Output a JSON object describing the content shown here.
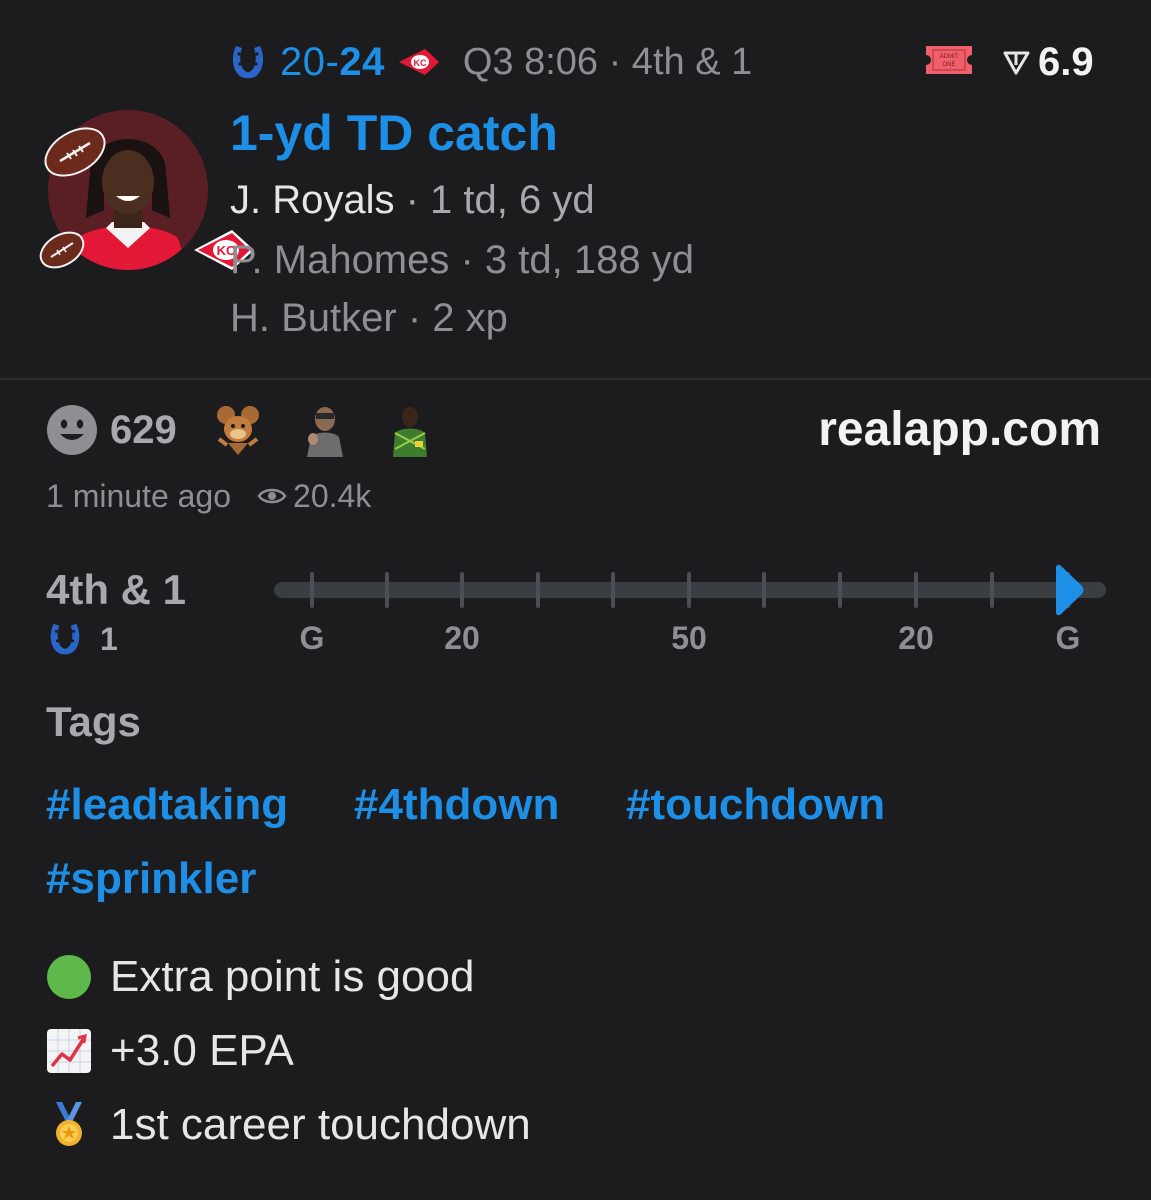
{
  "header": {
    "score_away": "20",
    "score_sep": "-",
    "score_home": "24",
    "game_status": "Q3 8:06 · 4th & 1",
    "ticket_text": "ADMIT ONE",
    "rating": "6.9"
  },
  "play": {
    "title": "1-yd TD catch",
    "stats": [
      {
        "name": "J. Royals",
        "line": " · 1 td, 6 yd"
      },
      {
        "name": "P. Mahomes",
        "line": " · 3 td, 188 yd"
      },
      {
        "name": "H. Butker",
        "line": " · 2 xp"
      }
    ]
  },
  "reactions": {
    "count": "629",
    "stickers": [
      "cartoon-mouse-sticker",
      "person-sticker",
      "goalkeeper-sticker"
    ],
    "site": "realapp.com"
  },
  "meta": {
    "time_ago": "1 minute ago",
    "views": "20.4k"
  },
  "field": {
    "down": "4th & 1",
    "yard_line": "1",
    "labels": [
      "G",
      "20",
      "50",
      "20",
      "G"
    ],
    "ball_position_fraction": 0.955
  },
  "tags": {
    "title": "Tags",
    "items": [
      "#leadtaking",
      "#4thdown",
      "#touchdown",
      "#sprinkler"
    ]
  },
  "notes": [
    {
      "icon": "green-circle-icon",
      "text": "Extra point is good"
    },
    {
      "icon": "chart-up-icon",
      "text": "+3.0 EPA"
    },
    {
      "icon": "medal-icon",
      "text": "1st career touchdown"
    }
  ],
  "colors": {
    "background": "#1c1c1e",
    "accent": "#1e8fe6",
    "chiefs_red": "#e31837",
    "colts_blue": "#1e5aa8"
  }
}
